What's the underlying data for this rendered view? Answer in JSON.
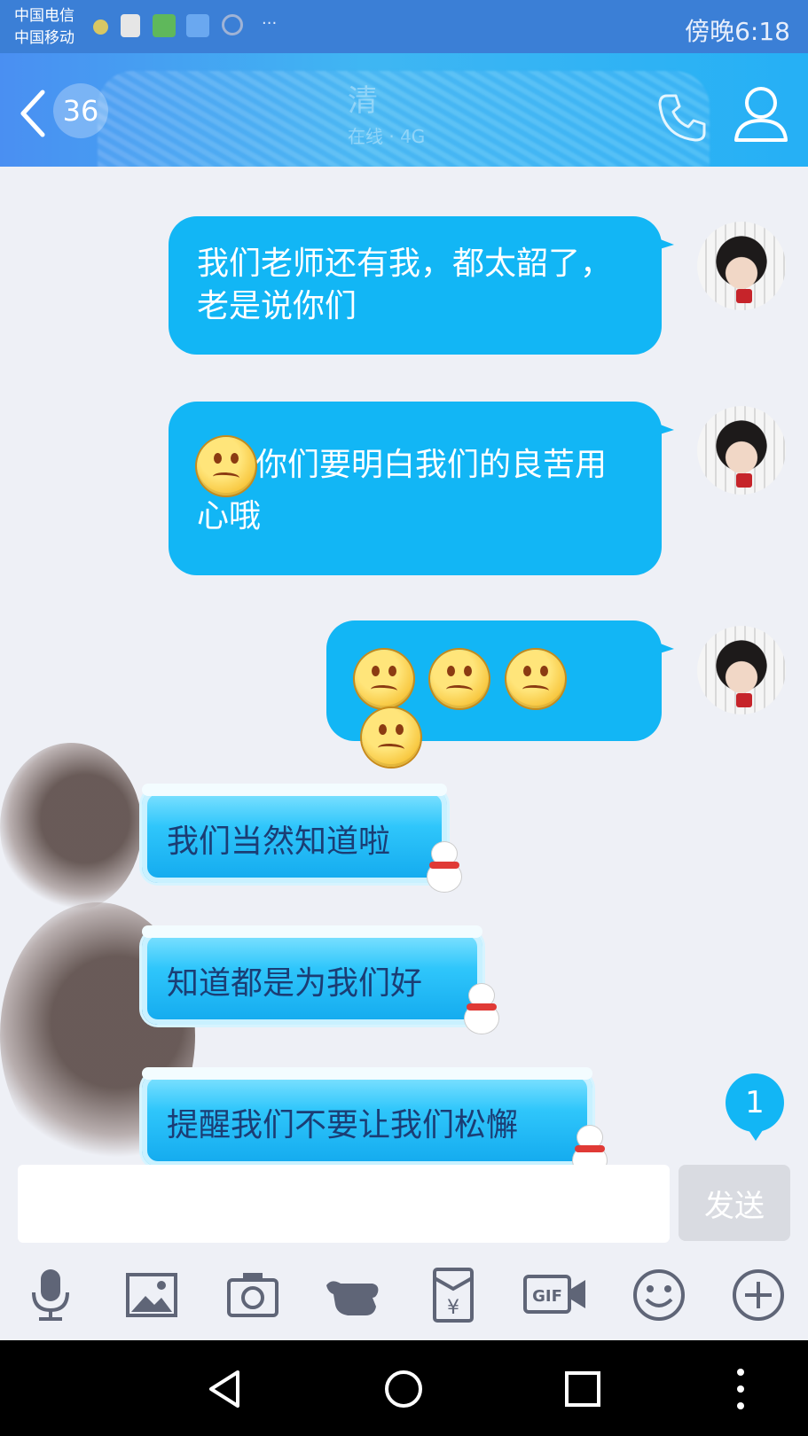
{
  "statusbar": {
    "carrier_1": "中国电信",
    "carrier_2": "中国移动",
    "overflow": "···",
    "time": "傍晚6:18"
  },
  "header": {
    "unread_count": "36",
    "contact_name": "清",
    "contact_status": "在线 · 4G"
  },
  "messages": [
    {
      "side": "right",
      "text": "我们老师还有我，都太韶了，老是说你们"
    },
    {
      "side": "right",
      "text": "你们要明白我们的良苦用心哦",
      "emoji": "worried-face"
    },
    {
      "side": "right",
      "emojis": [
        "worried-face",
        "worried-face",
        "worried-face",
        "worried-face"
      ]
    },
    {
      "side": "left",
      "text": "我们当然知道啦"
    },
    {
      "side": "left",
      "text": "知道都是为我们好"
    },
    {
      "side": "left",
      "text": "提醒我们不要让我们松懈"
    }
  ],
  "new_message_count": "1",
  "input": {
    "placeholder": "",
    "send_label": "发送"
  },
  "toolbar_icons": [
    "microphone-icon",
    "image-icon",
    "camera-icon",
    "poke-icon",
    "red-packet-icon",
    "gif-icon",
    "emoji-icon",
    "plus-icon"
  ],
  "colors": {
    "header_start": "#4a8ff2",
    "header_end": "#25b0f5",
    "bubble_blue": "#12b6f5",
    "background": "#eef0f6"
  }
}
